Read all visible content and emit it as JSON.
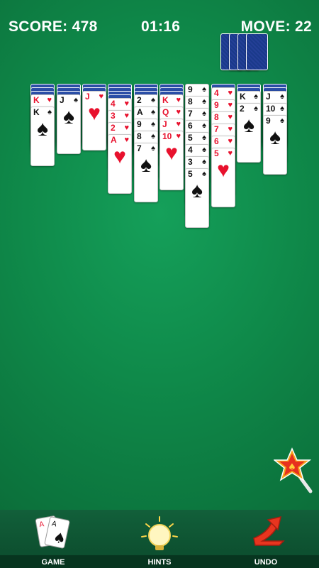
{
  "hud": {
    "score": "SCORE: 478",
    "time": "01:16",
    "moves": "MOVE: 22"
  },
  "stock": {
    "count": 4
  },
  "colors": {
    "felt": "#0f8a4a",
    "card_back": "#1b3580",
    "red": "#e8112d",
    "black": "#111111"
  },
  "columns": [
    {
      "down": 3,
      "up": [
        {
          "r": "K",
          "s": "♥"
        },
        {
          "r": "K",
          "s": "♠"
        }
      ]
    },
    {
      "down": 3,
      "up": [
        {
          "r": "J",
          "s": "♠"
        }
      ]
    },
    {
      "down": 2,
      "up": [
        {
          "r": "J",
          "s": "♥"
        }
      ]
    },
    {
      "down": 4,
      "up": [
        {
          "r": "4",
          "s": "♥"
        },
        {
          "r": "3",
          "s": "♥"
        },
        {
          "r": "2",
          "s": "♥"
        },
        {
          "r": "A",
          "s": "♥"
        }
      ]
    },
    {
      "down": 3,
      "up": [
        {
          "r": "2",
          "s": "♠"
        },
        {
          "r": "A",
          "s": "♠"
        },
        {
          "r": "9",
          "s": "♠"
        },
        {
          "r": "8",
          "s": "♠"
        },
        {
          "r": "7",
          "s": "♠"
        }
      ]
    },
    {
      "down": 3,
      "up": [
        {
          "r": "K",
          "s": "♥"
        },
        {
          "r": "Q",
          "s": "♥"
        },
        {
          "r": "J",
          "s": "♥"
        },
        {
          "r": "10",
          "s": "♥"
        }
      ]
    },
    {
      "down": 0,
      "up": [
        {
          "r": "9",
          "s": "♠"
        },
        {
          "r": "8",
          "s": "♠"
        },
        {
          "r": "7",
          "s": "♠"
        },
        {
          "r": "6",
          "s": "♠"
        },
        {
          "r": "5",
          "s": "♠"
        },
        {
          "r": "4",
          "s": "♠"
        },
        {
          "r": "3",
          "s": "♠"
        },
        {
          "r": "5",
          "s": "♠"
        }
      ]
    },
    {
      "down": 1,
      "up": [
        {
          "r": "4",
          "s": "♥"
        },
        {
          "r": "9",
          "s": "♥"
        },
        {
          "r": "8",
          "s": "♥"
        },
        {
          "r": "7",
          "s": "♥"
        },
        {
          "r": "6",
          "s": "♥"
        },
        {
          "r": "5",
          "s": "♥"
        }
      ]
    },
    {
      "down": 2,
      "up": [
        {
          "r": "K",
          "s": "♠"
        },
        {
          "r": "2",
          "s": "♠"
        }
      ]
    },
    {
      "down": 2,
      "up": [
        {
          "r": "J",
          "s": "♠"
        },
        {
          "r": "10",
          "s": "♠"
        },
        {
          "r": "9",
          "s": "♠"
        }
      ]
    }
  ],
  "footer": {
    "game": "GAME",
    "hints": "HINTS",
    "undo": "UNDO"
  },
  "icons": {
    "game": "cards-icon",
    "hints": "lightbulb-icon",
    "undo": "undo-arrow-icon",
    "magic": "magic-wand-star-icon"
  }
}
